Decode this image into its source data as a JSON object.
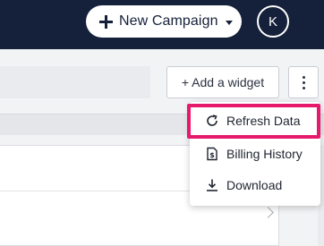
{
  "header": {
    "new_campaign_label": "New Campaign",
    "avatar_initial": "K"
  },
  "toolbar": {
    "add_widget_label": "+ Add a widget"
  },
  "dropdown": {
    "items": [
      {
        "label": "Refresh Data",
        "icon": "refresh-icon"
      },
      {
        "label": "Billing History",
        "icon": "billing-history-icon"
      },
      {
        "label": "Download",
        "icon": "download-icon"
      }
    ]
  },
  "colors": {
    "header_bg": "#15213a",
    "highlight": "#e6196c",
    "page_bg": "#f2f3f5"
  }
}
